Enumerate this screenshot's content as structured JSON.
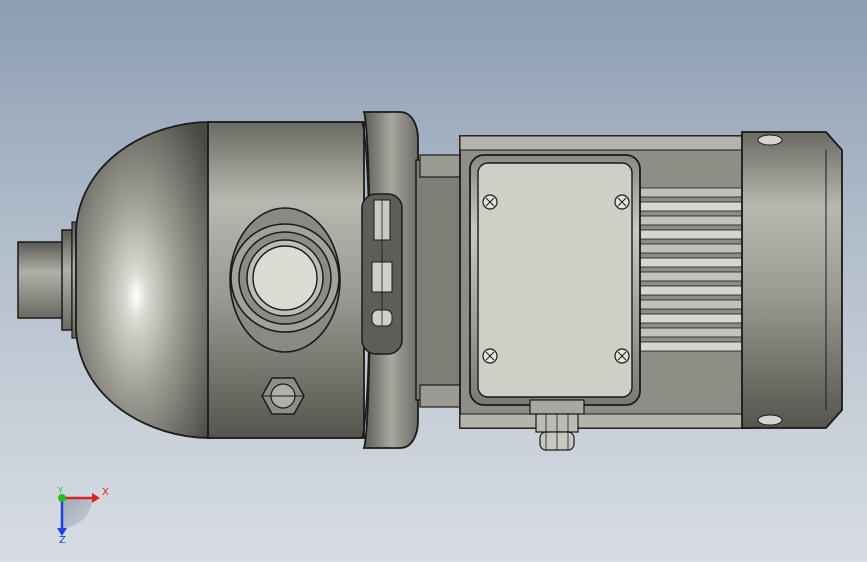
{
  "viewport": {
    "background_top": "#8c9db3",
    "background_bottom": "#d8dde3"
  },
  "model": {
    "parts": [
      "outlet-nozzle",
      "pump-housing-dome",
      "discharge-port",
      "drain-plug-hex",
      "coupling-flange",
      "lantern-window",
      "motor-frame-finned",
      "terminal-box",
      "cable-gland",
      "fan-cover"
    ],
    "body_color": "#9a9a92",
    "cover_color": "#c6c6bd",
    "edge_color": "#1a1a1a"
  },
  "triad": {
    "x_label": "X",
    "y_label": "Y",
    "z_label": "Z",
    "x_color": "#e02020",
    "y_color": "#20c020",
    "z_color": "#2040e0"
  }
}
